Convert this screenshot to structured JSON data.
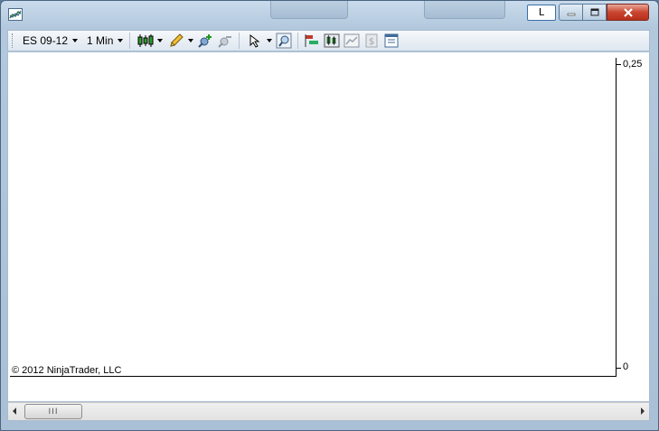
{
  "window": {
    "title": "",
    "link_button_label": "L"
  },
  "toolbar": {
    "instrument": "ES 09-12",
    "interval": "1 Min",
    "icons": [
      "bar-type-icon",
      "drawing-tools-icon",
      "add-indicator-icon",
      "remove-indicator-icon",
      "cursor-icon",
      "zoom-icon",
      "strategy-icon",
      "chart-trader-icon",
      "data-series-icon",
      "dollar-icon",
      "properties-icon"
    ]
  },
  "chart": {
    "y_labels": [
      "0,25",
      "0"
    ],
    "copyright": "© 2012 NinjaTrader, LLC"
  },
  "scrollbar": {
    "thumb_grip": "III"
  },
  "colors": {
    "window_chrome": "#b3c8dd",
    "close_button": "#c9452f",
    "toolbar_bg": "#dde6f0",
    "chart_bg": "#ffffff"
  }
}
